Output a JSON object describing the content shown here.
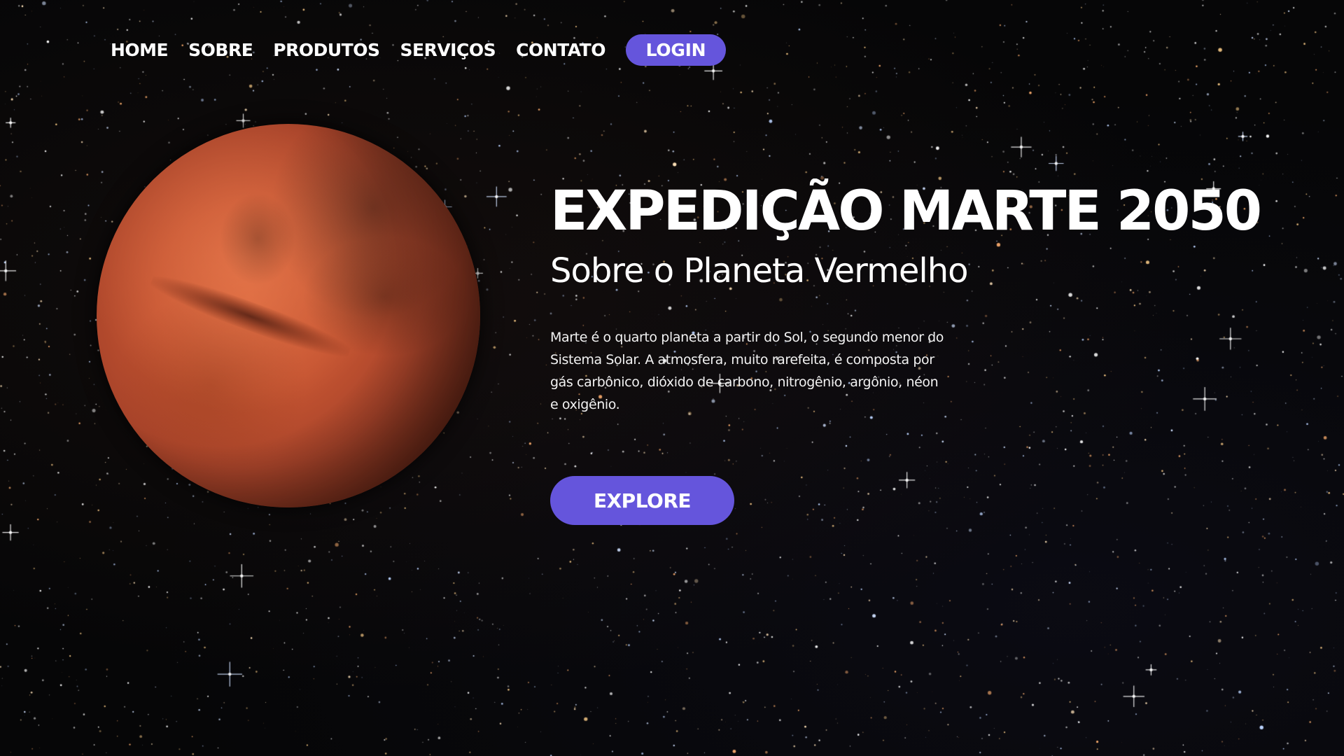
{
  "nav": {
    "links": [
      "HOME",
      "SOBRE",
      "PRODUTOS",
      "SERVIÇOS",
      "CONTATO"
    ],
    "login_label": "LOGIN"
  },
  "hero": {
    "title": "EXPEDIÇÃO MARTE 2050",
    "subtitle": "Sobre o Planeta Vermelho",
    "description": "Marte é o quarto planeta a partir do Sol, o segundo menor do Sistema Solar. A atmosfera, muito rarefeita, é composta por gás carbônico, dióxido de carbono, nitrogênio, argônio, néon e oxigênio.",
    "explore_label": "EXPLORE"
  },
  "colors": {
    "accent": "#6555dc",
    "background": "#060607",
    "text": "#ffffff"
  }
}
